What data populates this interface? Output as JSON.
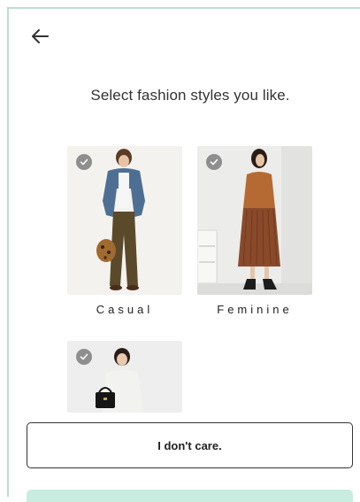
{
  "header": {
    "back_icon": "arrow-left-icon"
  },
  "title": "Select fashion styles you like.",
  "styles": [
    {
      "label": "Casual",
      "selected": true,
      "check_icon": "check-icon"
    },
    {
      "label": "Feminine",
      "selected": true,
      "check_icon": "check-icon"
    },
    {
      "label": "",
      "selected": true,
      "check_icon": "check-icon"
    }
  ],
  "skip_button": {
    "label": "I don't care."
  },
  "colors": {
    "accent_border": "#b9e0cf",
    "next_button": "#c9ece1",
    "check_badge": "#8e8e8e"
  }
}
